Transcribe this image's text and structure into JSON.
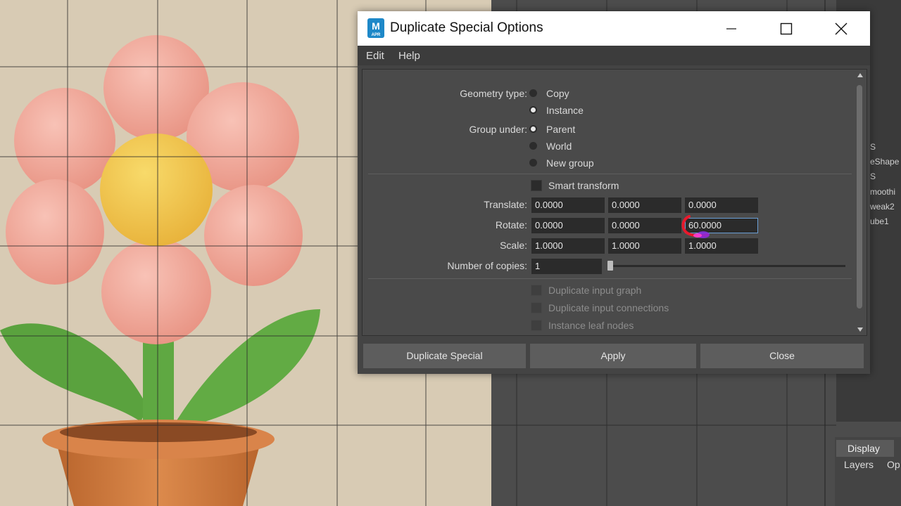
{
  "dialog": {
    "title": "Duplicate Special Options",
    "app_logo": "M",
    "app_logo_sub": "APR",
    "menu": [
      "Edit",
      "Help"
    ],
    "geometry_type": {
      "label": "Geometry type:",
      "options": [
        "Copy",
        "Instance"
      ],
      "selected": "Instance"
    },
    "group_under": {
      "label": "Group under:",
      "options": [
        "Parent",
        "World",
        "New group"
      ],
      "selected": "Parent"
    },
    "smart_transform": {
      "label": "Smart transform",
      "checked": false
    },
    "translate": {
      "label": "Translate:",
      "values": [
        "0.0000",
        "0.0000",
        "0.0000"
      ]
    },
    "rotate": {
      "label": "Rotate:",
      "values": [
        "0.0000",
        "0.0000",
        "60.0000"
      ]
    },
    "scale": {
      "label": "Scale:",
      "values": [
        "1.0000",
        "1.0000",
        "1.0000"
      ]
    },
    "copies": {
      "label": "Number of copies:",
      "value": "1"
    },
    "disabled_options": [
      "Duplicate input graph",
      "Duplicate input connections",
      "Instance leaf nodes"
    ],
    "buttons": {
      "duplicate": "Duplicate Special",
      "apply": "Apply",
      "close": "Close"
    }
  },
  "background_ui": {
    "outliner_items": [
      "S",
      "eShape",
      "S",
      "moothi",
      "weak2",
      "ube1"
    ],
    "display_tab": "Display",
    "layers_menu": "Layers",
    "options_menu": "Op"
  },
  "colors": {
    "petal": "#f0a89a",
    "flower_center": "#f2c64a",
    "leaf": "#5aa23e",
    "pot": "#cf7a3f",
    "dialog_bg": "#444444",
    "annotation_red": "#e8192c"
  }
}
